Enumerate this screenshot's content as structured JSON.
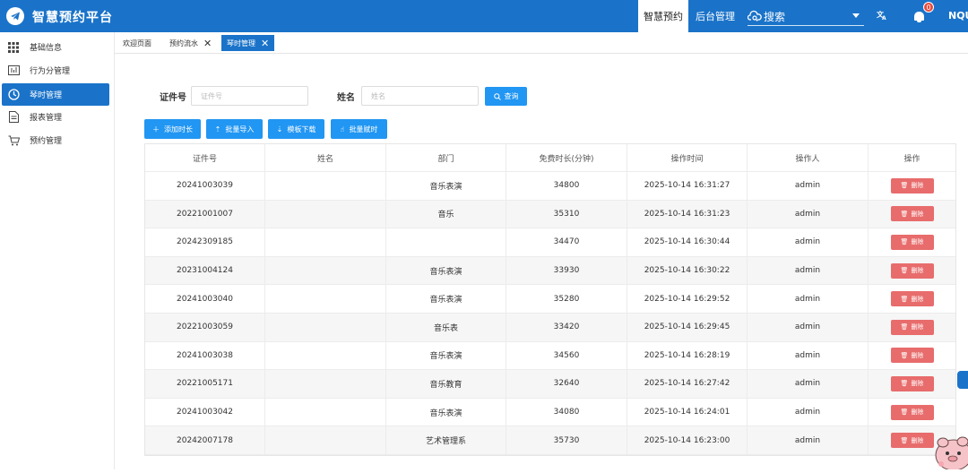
{
  "header": {
    "app_title": "智慧预约平台",
    "nav_active": "智慧预约",
    "nav_admin": "后台管理",
    "search_placeholder": "搜索",
    "bell_count": "0",
    "username": "NQU"
  },
  "sidebar": {
    "items": [
      {
        "label": "基础信息",
        "icon": "grid-icon"
      },
      {
        "label": "行为分管理",
        "icon": "chart-icon"
      },
      {
        "label": "琴时管理",
        "icon": "clock-icon",
        "active": true
      },
      {
        "label": "报表管理",
        "icon": "document-icon"
      },
      {
        "label": "预约管理",
        "icon": "cart-icon"
      }
    ]
  },
  "tabs": [
    {
      "label": "欢迎页面"
    },
    {
      "label": "预约流水"
    },
    {
      "label": "琴时管理"
    }
  ],
  "search_form": {
    "cert_label": "证件号",
    "cert_placeholder": "证件号",
    "name_label": "姓名",
    "name_placeholder": "姓名",
    "query_button": "查询"
  },
  "toolbar": {
    "add_hours": "添加时长",
    "batch_import": "批量导入",
    "template_download": "模板下载",
    "batch_assign": "批量赋时"
  },
  "table": {
    "headers": [
      "证件号",
      "姓名",
      "部门",
      "免费时长(分钟)",
      "操作时间",
      "操作人",
      "操作"
    ],
    "delete_label": "删除",
    "rows": [
      {
        "cert": "20241003039",
        "name": "",
        "dept": "音乐表演",
        "minutes": "34800",
        "time": "2025-10-14 16:31:27",
        "operator": "admin"
      },
      {
        "cert": "20221001007",
        "name": "",
        "dept": "音乐",
        "minutes": "35310",
        "time": "2025-10-14 16:31:23",
        "operator": "admin"
      },
      {
        "cert": "20242309185",
        "name": "",
        "dept": "",
        "minutes": "34470",
        "time": "2025-10-14 16:30:44",
        "operator": "admin"
      },
      {
        "cert": "20231004124",
        "name": "",
        "dept": "音乐表演",
        "minutes": "33930",
        "time": "2025-10-14 16:30:22",
        "operator": "admin"
      },
      {
        "cert": "20241003040",
        "name": "",
        "dept": "音乐表演",
        "minutes": "35280",
        "time": "2025-10-14 16:29:52",
        "operator": "admin"
      },
      {
        "cert": "20221003059",
        "name": "",
        "dept": "音乐表",
        "minutes": "33420",
        "time": "2025-10-14 16:29:45",
        "operator": "admin"
      },
      {
        "cert": "20241003038",
        "name": "",
        "dept": "音乐表演",
        "minutes": "34560",
        "time": "2025-10-14 16:28:19",
        "operator": "admin"
      },
      {
        "cert": "20221005171",
        "name": "",
        "dept": "音乐教育",
        "minutes": "32640",
        "time": "2025-10-14 16:27:42",
        "operator": "admin"
      },
      {
        "cert": "20241003042",
        "name": "",
        "dept": "音乐表演",
        "minutes": "34080",
        "time": "2025-10-14 16:24:01",
        "operator": "admin"
      },
      {
        "cert": "20242007178",
        "name": "",
        "dept": "艺术管理系",
        "minutes": "35730",
        "time": "2025-10-14 16:23:00",
        "operator": "admin"
      }
    ]
  },
  "colors": {
    "primary": "#1a73c9",
    "button": "#2196f3",
    "danger": "#e86c6c"
  }
}
